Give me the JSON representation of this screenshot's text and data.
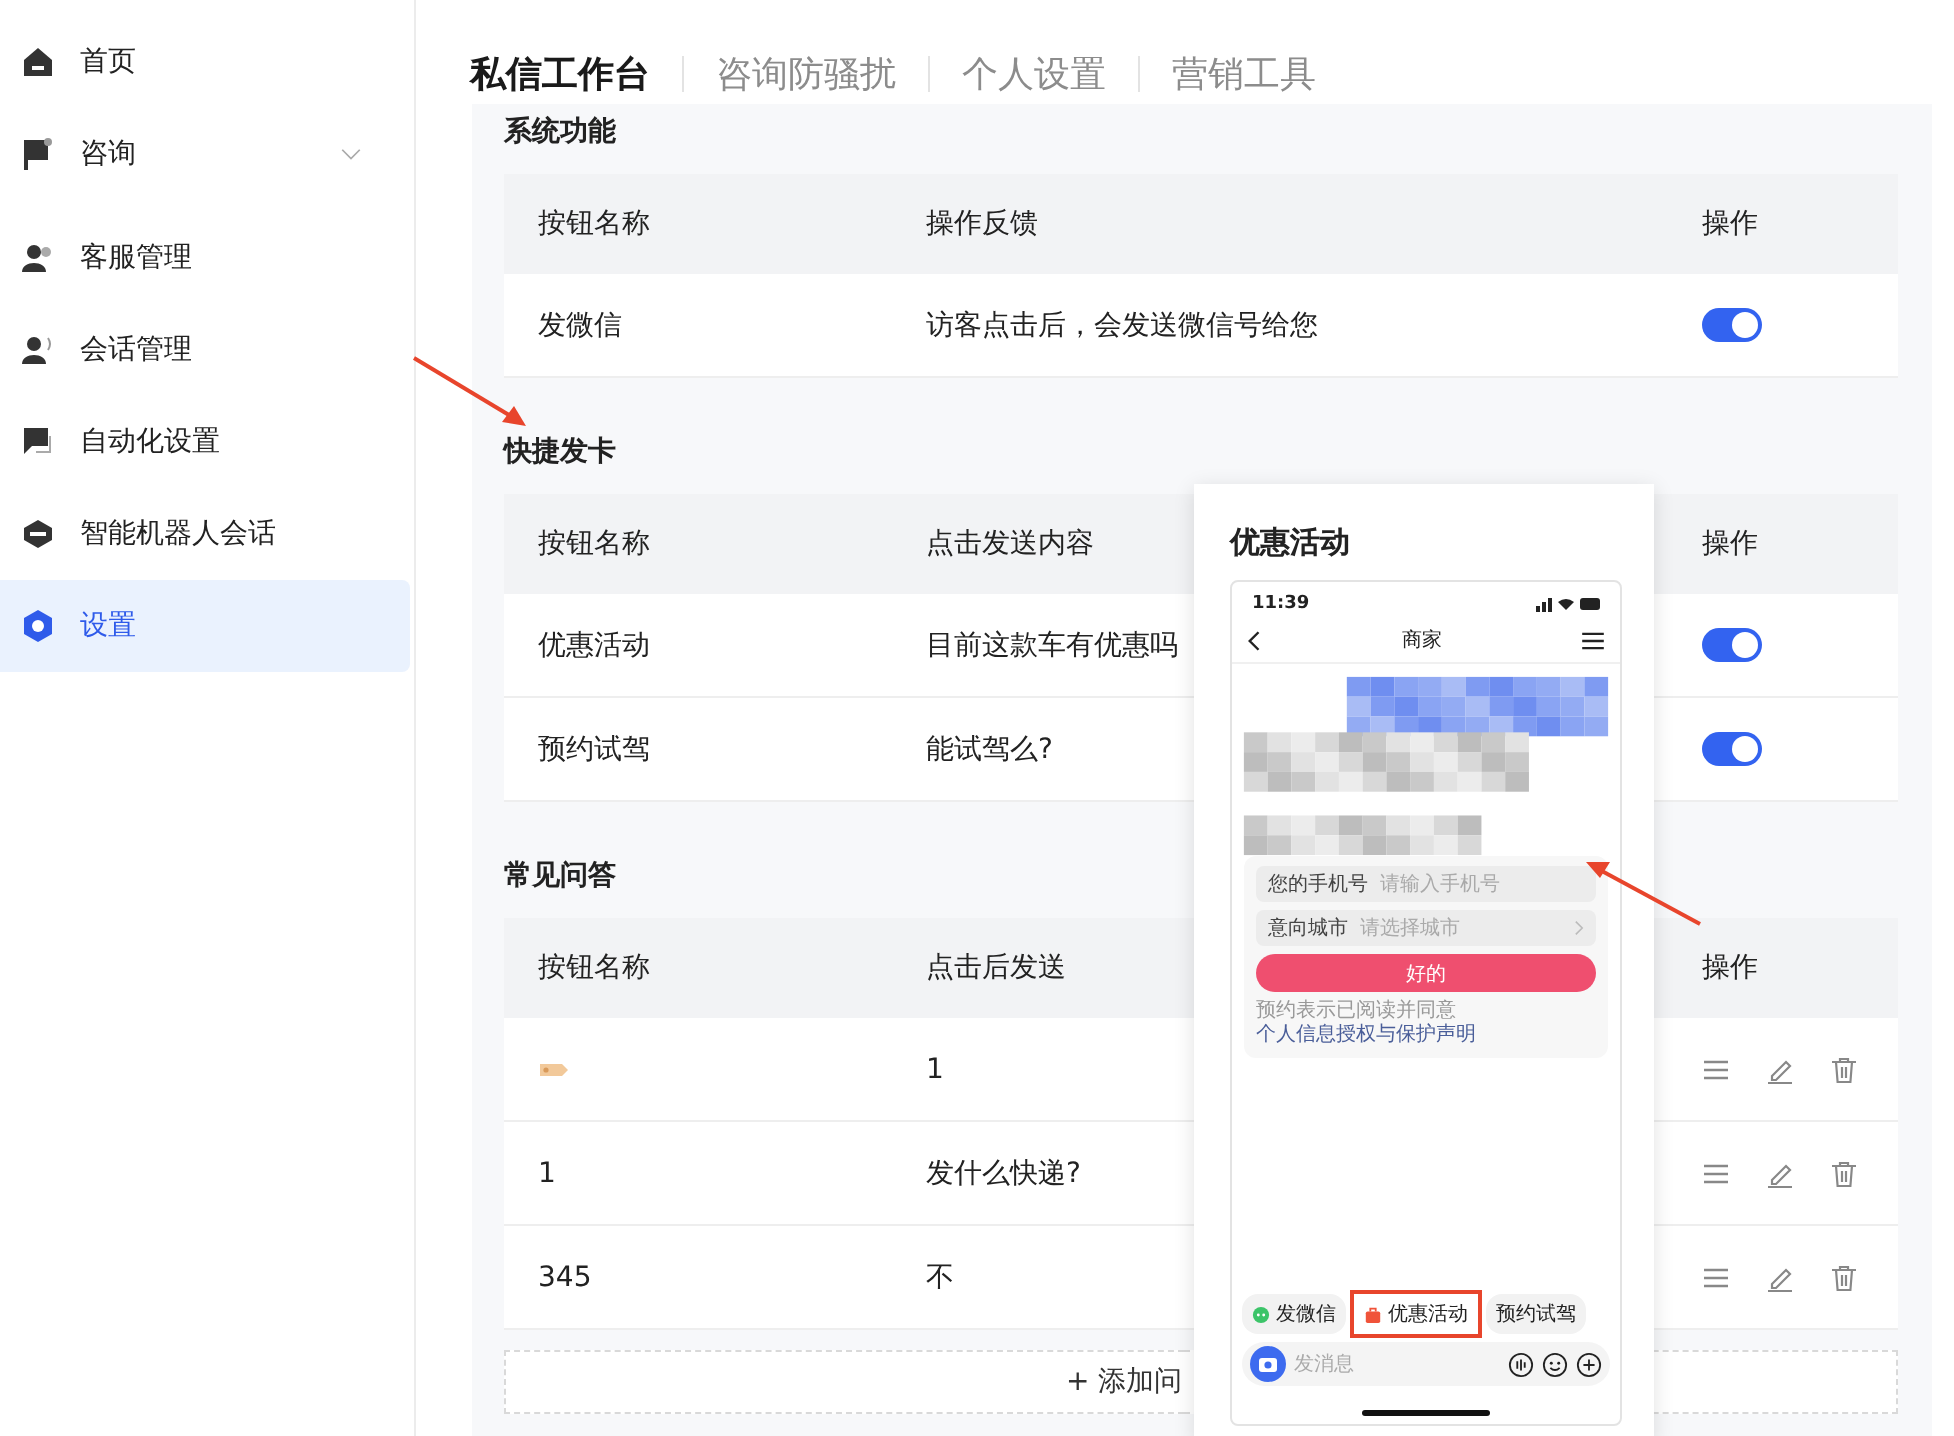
{
  "sidebar": {
    "items": [
      {
        "label": "首页",
        "kind": "link",
        "selected": false
      },
      {
        "label": "咨询",
        "kind": "group",
        "expanded": false,
        "selected": false
      },
      {
        "label": "客服管理",
        "kind": "link",
        "selected": false
      },
      {
        "label": "会话管理",
        "kind": "link",
        "selected": false
      },
      {
        "label": "自动化设置",
        "kind": "link",
        "selected": false
      },
      {
        "label": "智能机器人会话",
        "kind": "link",
        "selected": false
      },
      {
        "label": "设置",
        "kind": "link",
        "selected": true
      }
    ]
  },
  "tabs": [
    {
      "label": "私信工作台",
      "selected": true
    },
    {
      "label": "咨询防骚扰",
      "selected": false
    },
    {
      "label": "个人设置",
      "selected": false
    },
    {
      "label": "营销工具",
      "selected": false
    }
  ],
  "sections": [
    {
      "title": "系统功能",
      "columns": [
        "按钮名称",
        "操作反馈",
        "操作"
      ],
      "rows": [
        {
          "kind": "toggle",
          "name": "发微信",
          "content": "访客点击后，会发送微信号给您",
          "on": true
        }
      ]
    },
    {
      "title": "快捷发卡",
      "columns": [
        "按钮名称",
        "点击发送内容",
        "操作"
      ],
      "rows": [
        {
          "kind": "toggle",
          "name": "优惠活动",
          "content": "目前这款车有优惠吗",
          "on": true
        },
        {
          "kind": "toggle",
          "name": "预约试驾",
          "content": "能试驾么?",
          "on": true
        }
      ]
    },
    {
      "title": "常见问答",
      "columns": [
        "按钮名称",
        "点击后发送",
        "操作"
      ],
      "rows": [
        {
          "kind": "sticker-actions",
          "content": "1"
        },
        {
          "kind": "actions",
          "name": "1",
          "content": "发什么快递?"
        },
        {
          "kind": "actions",
          "name": "345",
          "content": "不"
        }
      ],
      "add_button": "+ 添加问"
    }
  ],
  "preview": {
    "title": "优惠活动",
    "phone": {
      "time": "11:39",
      "header": "商家",
      "form": {
        "fields": [
          {
            "label": "您的手机号",
            "placeholder": "请输入手机号",
            "kind": "input"
          },
          {
            "label": "意向城市",
            "placeholder": "请选择城市",
            "kind": "select"
          }
        ],
        "button": "好的",
        "note": "预约表示已阅读并同意",
        "note_link": "个人信息授权与保护声明"
      },
      "quick_replies": [
        {
          "label": "发微信",
          "kind": "wechat",
          "highlighted": false
        },
        {
          "label": "优惠活动",
          "kind": "promo",
          "highlighted": true
        },
        {
          "label": "预约试驾",
          "kind": "plain",
          "highlighted": false
        }
      ],
      "input_placeholder": "发消息"
    }
  }
}
